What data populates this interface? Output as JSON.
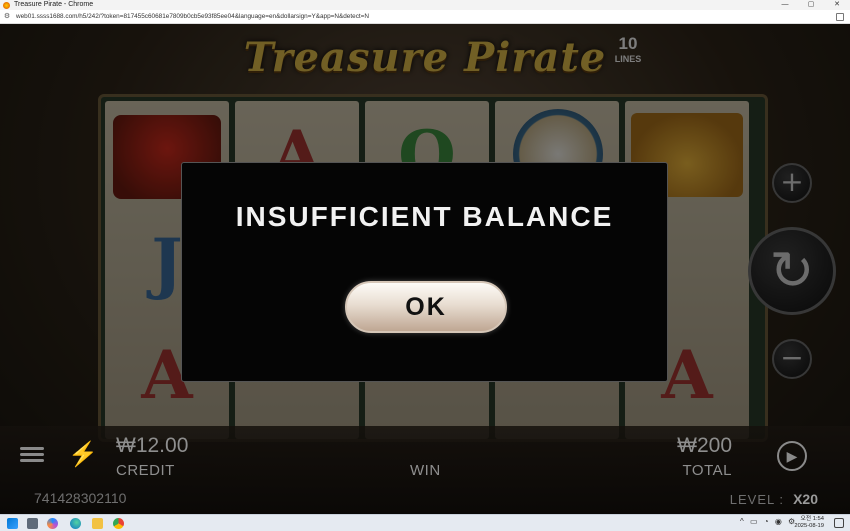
{
  "window": {
    "title": "Treasure Pirate - Chrome",
    "controls": [
      "—",
      "▢",
      "✕"
    ]
  },
  "address_bar": {
    "url": "web01.ssss1688.com/h5/242/?token=817455c60681e7809b0cb5e93f85ee04&language=en&dollarsign=Y&app=N&detect=N"
  },
  "game": {
    "logo_text": "Treasure Pirate",
    "lines": {
      "number": "10",
      "label": "LINES"
    },
    "reel_symbols": [
      [
        "flag",
        "J",
        "A"
      ],
      [
        "A",
        "",
        ""
      ],
      [
        "Q",
        "",
        ""
      ],
      [
        "compass",
        "",
        ""
      ],
      [
        "gold",
        "",
        "A"
      ]
    ],
    "side_buttons": {
      "plus": "+",
      "spin": "↻",
      "minus": "−"
    }
  },
  "bottom_bar": {
    "credit_amount": "₩12.00",
    "credit_label": "CREDIT",
    "win_label": "WIN",
    "total_amount": "₩200",
    "total_label": "TOTAL",
    "round_id": "741428302110",
    "level_label": "LEVEL :",
    "level_value": "X20"
  },
  "modal": {
    "message": "INSUFFICIENT BALANCE",
    "button_label": "OK"
  },
  "taskbar": {
    "clock_time": "오전 1:54",
    "clock_date": "2025-08-19"
  }
}
